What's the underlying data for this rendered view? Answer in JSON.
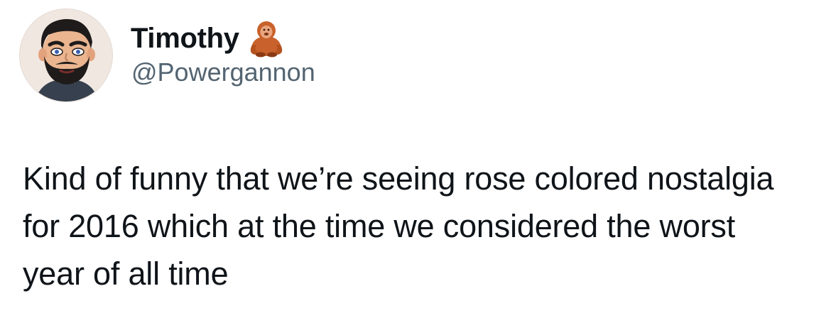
{
  "author": {
    "display_name": "Timothy",
    "handle": "@Powergannon",
    "name_emoji": "orangutan-emoji",
    "avatar": "cartoon-bearded-man-avatar"
  },
  "tweet": {
    "text": "Kind of funny that we’re seeing rose colored nostalgia for 2016 which at the time we considered the worst year of all time"
  },
  "colors": {
    "text": "#0f1419",
    "handle": "#536471",
    "background": "#ffffff"
  }
}
